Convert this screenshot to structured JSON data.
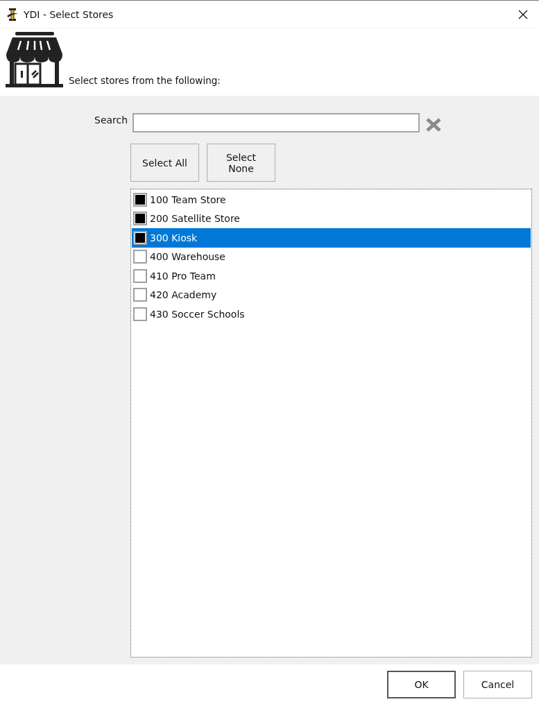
{
  "window": {
    "title": "YDI - Select Stores"
  },
  "header": {
    "prompt": "Select stores from the following:"
  },
  "search": {
    "label": "Search"
  },
  "buttons": [
    {
      "label": "Select All"
    },
    {
      "label": "Select None"
    }
  ],
  "stores": [
    {
      "label": "100 Team Store",
      "checked": true,
      "selected": false
    },
    {
      "label": "200 Satellite Store",
      "checked": true,
      "selected": false
    },
    {
      "label": "300 Kiosk",
      "checked": true,
      "selected": true
    },
    {
      "label": "400 Warehouse",
      "checked": false,
      "selected": false
    },
    {
      "label": "410 Pro Team",
      "checked": false,
      "selected": false
    },
    {
      "label": "420 Academy",
      "checked": false,
      "selected": false
    },
    {
      "label": "430 Soccer Schools",
      "checked": false,
      "selected": false
    }
  ],
  "footer": {
    "ok": "OK",
    "cancel": "Cancel"
  }
}
